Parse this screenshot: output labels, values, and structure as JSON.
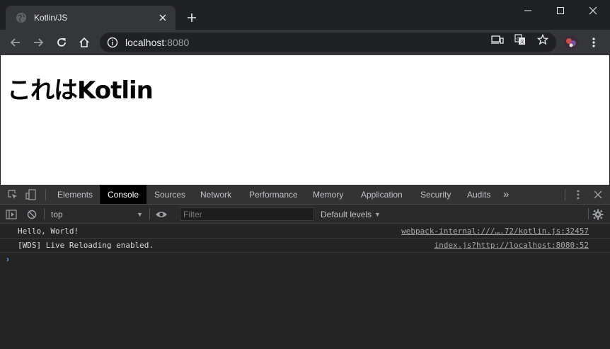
{
  "browser": {
    "tab": {
      "title": "Kotlin/JS"
    },
    "address": {
      "host": "localhost",
      "port": ":8080"
    }
  },
  "page": {
    "heading": "これはKotlin"
  },
  "devtools": {
    "tabs": [
      {
        "label": "Elements"
      },
      {
        "label": "Console"
      },
      {
        "label": "Sources"
      },
      {
        "label": "Network"
      },
      {
        "label": "Performance"
      },
      {
        "label": "Memory"
      },
      {
        "label": "Application"
      },
      {
        "label": "Security"
      },
      {
        "label": "Audits"
      }
    ],
    "more_tabs_glyph": "»",
    "active_tab": "Console",
    "context": "top",
    "filter_placeholder": "Filter",
    "levels_label": "Default levels",
    "messages": [
      {
        "text": "Hello, World!",
        "source": "webpack-internal:///….72/kotlin.js:32457"
      },
      {
        "text": "[WDS] Live Reloading enabled.",
        "source": "index.js?http://localhost:8080:52"
      }
    ],
    "prompt_glyph": "›"
  },
  "colors": {
    "chrome_dark": "#202124",
    "toolbar": "#35363a",
    "devtools_bg": "#242424",
    "active_tab": "#000000",
    "prompt_accent": "#5d9bf0"
  }
}
